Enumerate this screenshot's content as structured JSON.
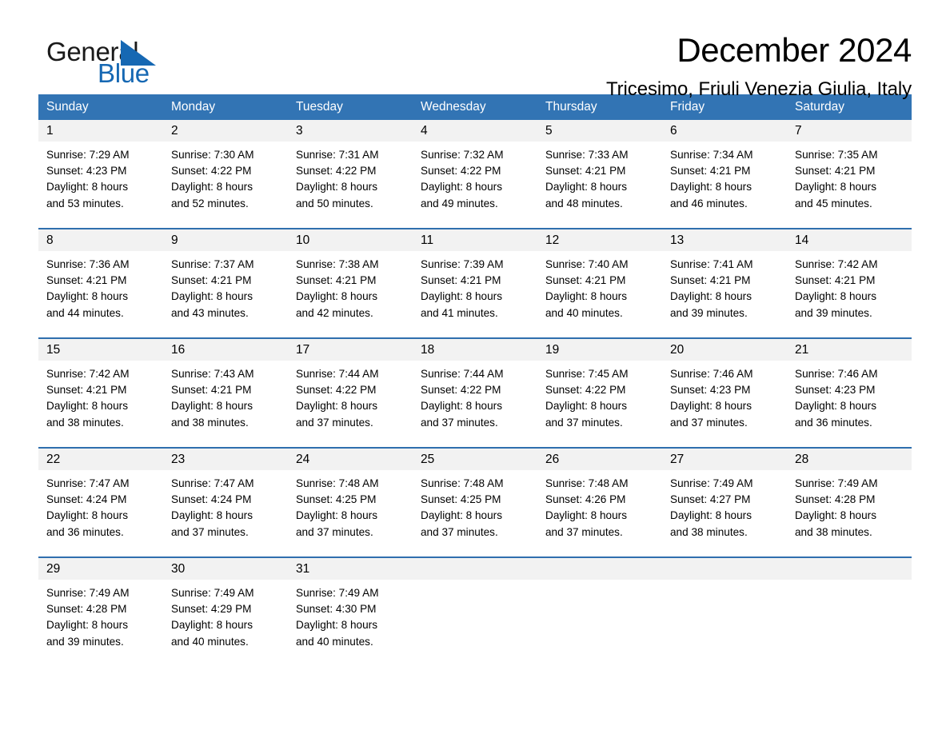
{
  "brand": {
    "name_part1": "General",
    "name_part2": "Blue",
    "accent_color": "#1668b3"
  },
  "header": {
    "title": "December 2024",
    "subtitle": "Tricesimo, Friuli Venezia Giulia, Italy"
  },
  "calendar": {
    "header_color": "#3274b4",
    "row_divider_color": "#2f6fae",
    "date_band_color": "#f2f2f2",
    "weekdays": [
      "Sunday",
      "Monday",
      "Tuesday",
      "Wednesday",
      "Thursday",
      "Friday",
      "Saturday"
    ],
    "weeks": [
      [
        {
          "day": "1",
          "sunrise": "Sunrise: 7:29 AM",
          "sunset": "Sunset: 4:23 PM",
          "daylight_1": "Daylight: 8 hours",
          "daylight_2": "and 53 minutes."
        },
        {
          "day": "2",
          "sunrise": "Sunrise: 7:30 AM",
          "sunset": "Sunset: 4:22 PM",
          "daylight_1": "Daylight: 8 hours",
          "daylight_2": "and 52 minutes."
        },
        {
          "day": "3",
          "sunrise": "Sunrise: 7:31 AM",
          "sunset": "Sunset: 4:22 PM",
          "daylight_1": "Daylight: 8 hours",
          "daylight_2": "and 50 minutes."
        },
        {
          "day": "4",
          "sunrise": "Sunrise: 7:32 AM",
          "sunset": "Sunset: 4:22 PM",
          "daylight_1": "Daylight: 8 hours",
          "daylight_2": "and 49 minutes."
        },
        {
          "day": "5",
          "sunrise": "Sunrise: 7:33 AM",
          "sunset": "Sunset: 4:21 PM",
          "daylight_1": "Daylight: 8 hours",
          "daylight_2": "and 48 minutes."
        },
        {
          "day": "6",
          "sunrise": "Sunrise: 7:34 AM",
          "sunset": "Sunset: 4:21 PM",
          "daylight_1": "Daylight: 8 hours",
          "daylight_2": "and 46 minutes."
        },
        {
          "day": "7",
          "sunrise": "Sunrise: 7:35 AM",
          "sunset": "Sunset: 4:21 PM",
          "daylight_1": "Daylight: 8 hours",
          "daylight_2": "and 45 minutes."
        }
      ],
      [
        {
          "day": "8",
          "sunrise": "Sunrise: 7:36 AM",
          "sunset": "Sunset: 4:21 PM",
          "daylight_1": "Daylight: 8 hours",
          "daylight_2": "and 44 minutes."
        },
        {
          "day": "9",
          "sunrise": "Sunrise: 7:37 AM",
          "sunset": "Sunset: 4:21 PM",
          "daylight_1": "Daylight: 8 hours",
          "daylight_2": "and 43 minutes."
        },
        {
          "day": "10",
          "sunrise": "Sunrise: 7:38 AM",
          "sunset": "Sunset: 4:21 PM",
          "daylight_1": "Daylight: 8 hours",
          "daylight_2": "and 42 minutes."
        },
        {
          "day": "11",
          "sunrise": "Sunrise: 7:39 AM",
          "sunset": "Sunset: 4:21 PM",
          "daylight_1": "Daylight: 8 hours",
          "daylight_2": "and 41 minutes."
        },
        {
          "day": "12",
          "sunrise": "Sunrise: 7:40 AM",
          "sunset": "Sunset: 4:21 PM",
          "daylight_1": "Daylight: 8 hours",
          "daylight_2": "and 40 minutes."
        },
        {
          "day": "13",
          "sunrise": "Sunrise: 7:41 AM",
          "sunset": "Sunset: 4:21 PM",
          "daylight_1": "Daylight: 8 hours",
          "daylight_2": "and 39 minutes."
        },
        {
          "day": "14",
          "sunrise": "Sunrise: 7:42 AM",
          "sunset": "Sunset: 4:21 PM",
          "daylight_1": "Daylight: 8 hours",
          "daylight_2": "and 39 minutes."
        }
      ],
      [
        {
          "day": "15",
          "sunrise": "Sunrise: 7:42 AM",
          "sunset": "Sunset: 4:21 PM",
          "daylight_1": "Daylight: 8 hours",
          "daylight_2": "and 38 minutes."
        },
        {
          "day": "16",
          "sunrise": "Sunrise: 7:43 AM",
          "sunset": "Sunset: 4:21 PM",
          "daylight_1": "Daylight: 8 hours",
          "daylight_2": "and 38 minutes."
        },
        {
          "day": "17",
          "sunrise": "Sunrise: 7:44 AM",
          "sunset": "Sunset: 4:22 PM",
          "daylight_1": "Daylight: 8 hours",
          "daylight_2": "and 37 minutes."
        },
        {
          "day": "18",
          "sunrise": "Sunrise: 7:44 AM",
          "sunset": "Sunset: 4:22 PM",
          "daylight_1": "Daylight: 8 hours",
          "daylight_2": "and 37 minutes."
        },
        {
          "day": "19",
          "sunrise": "Sunrise: 7:45 AM",
          "sunset": "Sunset: 4:22 PM",
          "daylight_1": "Daylight: 8 hours",
          "daylight_2": "and 37 minutes."
        },
        {
          "day": "20",
          "sunrise": "Sunrise: 7:46 AM",
          "sunset": "Sunset: 4:23 PM",
          "daylight_1": "Daylight: 8 hours",
          "daylight_2": "and 37 minutes."
        },
        {
          "day": "21",
          "sunrise": "Sunrise: 7:46 AM",
          "sunset": "Sunset: 4:23 PM",
          "daylight_1": "Daylight: 8 hours",
          "daylight_2": "and 36 minutes."
        }
      ],
      [
        {
          "day": "22",
          "sunrise": "Sunrise: 7:47 AM",
          "sunset": "Sunset: 4:24 PM",
          "daylight_1": "Daylight: 8 hours",
          "daylight_2": "and 36 minutes."
        },
        {
          "day": "23",
          "sunrise": "Sunrise: 7:47 AM",
          "sunset": "Sunset: 4:24 PM",
          "daylight_1": "Daylight: 8 hours",
          "daylight_2": "and 37 minutes."
        },
        {
          "day": "24",
          "sunrise": "Sunrise: 7:48 AM",
          "sunset": "Sunset: 4:25 PM",
          "daylight_1": "Daylight: 8 hours",
          "daylight_2": "and 37 minutes."
        },
        {
          "day": "25",
          "sunrise": "Sunrise: 7:48 AM",
          "sunset": "Sunset: 4:25 PM",
          "daylight_1": "Daylight: 8 hours",
          "daylight_2": "and 37 minutes."
        },
        {
          "day": "26",
          "sunrise": "Sunrise: 7:48 AM",
          "sunset": "Sunset: 4:26 PM",
          "daylight_1": "Daylight: 8 hours",
          "daylight_2": "and 37 minutes."
        },
        {
          "day": "27",
          "sunrise": "Sunrise: 7:49 AM",
          "sunset": "Sunset: 4:27 PM",
          "daylight_1": "Daylight: 8 hours",
          "daylight_2": "and 38 minutes."
        },
        {
          "day": "28",
          "sunrise": "Sunrise: 7:49 AM",
          "sunset": "Sunset: 4:28 PM",
          "daylight_1": "Daylight: 8 hours",
          "daylight_2": "and 38 minutes."
        }
      ],
      [
        {
          "day": "29",
          "sunrise": "Sunrise: 7:49 AM",
          "sunset": "Sunset: 4:28 PM",
          "daylight_1": "Daylight: 8 hours",
          "daylight_2": "and 39 minutes."
        },
        {
          "day": "30",
          "sunrise": "Sunrise: 7:49 AM",
          "sunset": "Sunset: 4:29 PM",
          "daylight_1": "Daylight: 8 hours",
          "daylight_2": "and 40 minutes."
        },
        {
          "day": "31",
          "sunrise": "Sunrise: 7:49 AM",
          "sunset": "Sunset: 4:30 PM",
          "daylight_1": "Daylight: 8 hours",
          "daylight_2": "and 40 minutes."
        },
        {
          "day": "",
          "sunrise": "",
          "sunset": "",
          "daylight_1": "",
          "daylight_2": ""
        },
        {
          "day": "",
          "sunrise": "",
          "sunset": "",
          "daylight_1": "",
          "daylight_2": ""
        },
        {
          "day": "",
          "sunrise": "",
          "sunset": "",
          "daylight_1": "",
          "daylight_2": ""
        },
        {
          "day": "",
          "sunrise": "",
          "sunset": "",
          "daylight_1": "",
          "daylight_2": ""
        }
      ]
    ]
  }
}
